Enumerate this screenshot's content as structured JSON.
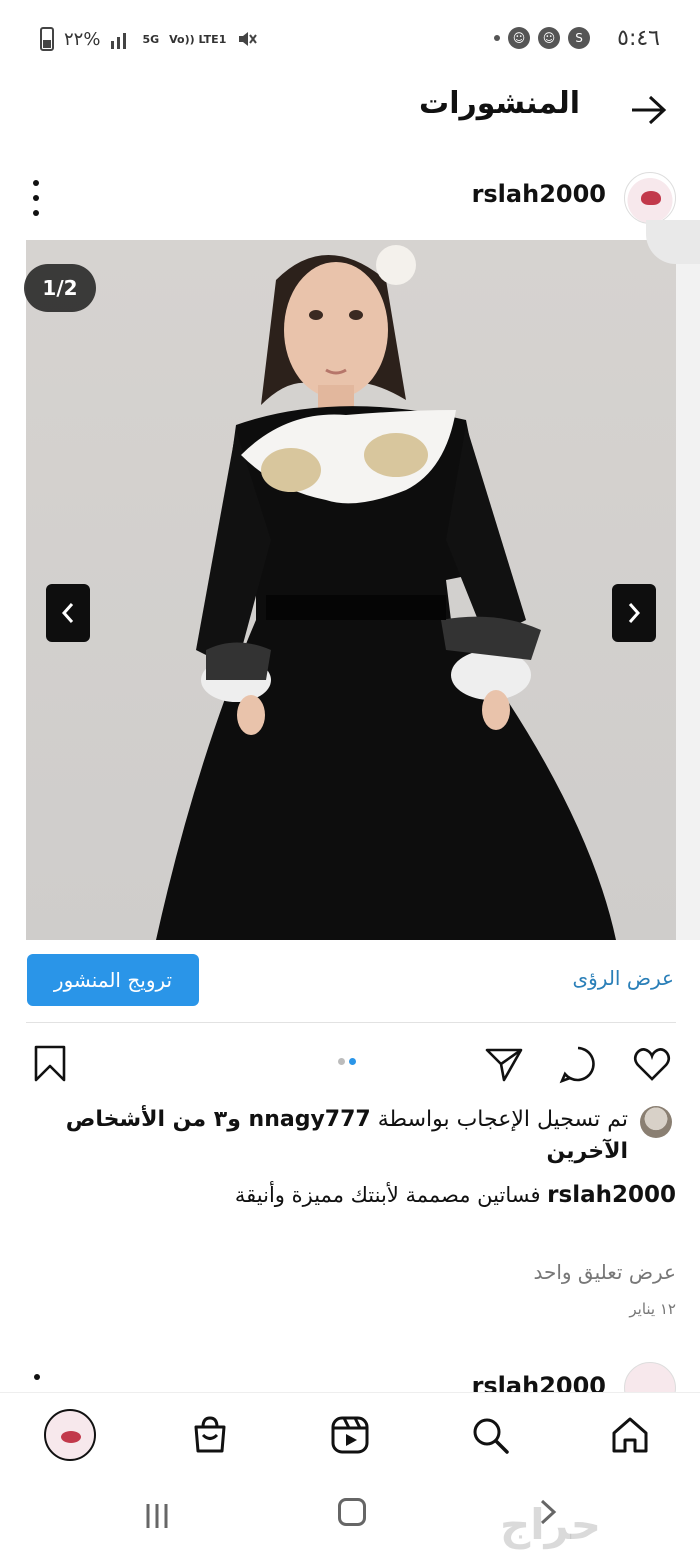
{
  "status_bar": {
    "time": "٥:٤٦",
    "battery": "٢٢%",
    "network": "5G",
    "volte": "Vo)) LTE1"
  },
  "header": {
    "title": "المنشورات"
  },
  "post": {
    "username": "rslah2000",
    "image_counter": "1/2",
    "insights_label": "عرض الرؤى",
    "promote_label": "ترويج المنشور",
    "likes_prefix": "تم تسجيل الإعجاب بواسطة ",
    "likes_user": "nnagy777",
    "likes_suffix": " و٣ من الأشخاص الآخرين",
    "caption_user": "rslah2000",
    "caption_text": " فساتين مصممة لأبنتك مميزة وأنيقة",
    "view_comments": "عرض تعليق واحد",
    "date": "١٢ يناير"
  },
  "next_post": {
    "username": "rslah2000"
  },
  "bottom_nav": {
    "items": [
      "home-icon",
      "search-icon",
      "reels-icon",
      "shop-icon",
      "profile-avatar"
    ]
  },
  "watermark": "حراج",
  "colors": {
    "accent": "#2a95e8",
    "link": "#2a7fb8"
  }
}
